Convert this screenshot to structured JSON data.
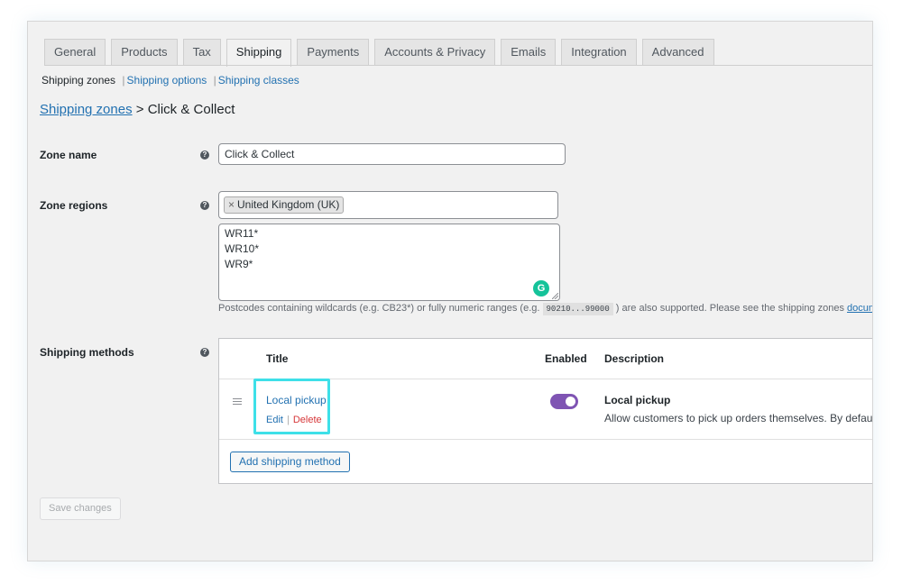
{
  "tabs": [
    {
      "label": "General"
    },
    {
      "label": "Products"
    },
    {
      "label": "Tax"
    },
    {
      "label": "Shipping"
    },
    {
      "label": "Payments"
    },
    {
      "label": "Accounts & Privacy"
    },
    {
      "label": "Emails"
    },
    {
      "label": "Integration"
    },
    {
      "label": "Advanced"
    }
  ],
  "active_tab": "Shipping",
  "subnav": {
    "current": "Shipping zones",
    "links": [
      "Shipping options",
      "Shipping classes"
    ]
  },
  "breadcrumb": {
    "link": "Shipping zones",
    "separator": ">",
    "current": "Click & Collect"
  },
  "zone_name": {
    "label": "Zone name",
    "value": "Click & Collect"
  },
  "zone_regions": {
    "label": "Zone regions",
    "chips": [
      "United Kingdom (UK)"
    ],
    "postcodes": [
      "WR11*",
      "WR10*",
      "WR9*"
    ],
    "hint_prefix": "Postcodes containing wildcards (e.g. CB23*) or fully numeric ranges (e.g.",
    "hint_code": "90210...99000",
    "hint_suffix": ") are also supported. Please see the shipping zones",
    "hint_link": "documenta"
  },
  "shipping_methods": {
    "label": "Shipping methods",
    "columns": {
      "title": "Title",
      "enabled": "Enabled",
      "description": "Description"
    },
    "rows": [
      {
        "title": "Local pickup",
        "edit": "Edit",
        "delete": "Delete",
        "enabled": true,
        "desc_title": "Local pickup",
        "desc_text": "Allow customers to pick up orders themselves. By default"
      }
    ],
    "add_button": "Add shipping method"
  },
  "save_button": "Save changes",
  "colors": {
    "link": "#2271b1",
    "delete": "#d63638",
    "toggle_on": "#7f54b3",
    "highlight": "#3ee0e8",
    "grammarly": "#15c39a"
  },
  "icons": {
    "help": "help-icon",
    "drag": "drag-handle-icon",
    "chip_remove": "close-icon",
    "grammarly": "grammarly-icon"
  }
}
